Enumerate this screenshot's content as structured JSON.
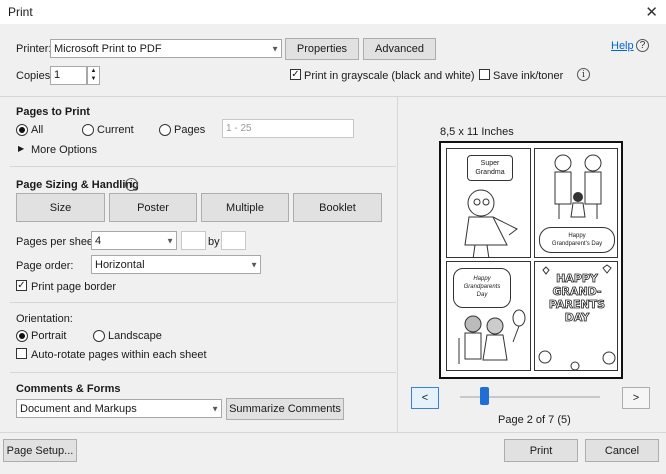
{
  "window": {
    "title": "Print",
    "close": "✕"
  },
  "header": {
    "printer_label": "Printer:",
    "printer_value": "Microsoft Print to PDF",
    "properties_label": "Properties",
    "advanced_label": "Advanced",
    "help_label": "Help",
    "copies_label": "Copies:",
    "copies_value": "1",
    "grayscale_label": "Print in grayscale (black and white)",
    "grayscale_checked": true,
    "save_ink_label": "Save ink/toner",
    "save_ink_checked": false
  },
  "pages_to_print": {
    "heading": "Pages to Print",
    "all_label": "All",
    "current_label": "Current",
    "pages_label": "Pages",
    "range_value": "1 - 25",
    "more_options_label": "More Options",
    "selected": "All"
  },
  "sizing": {
    "heading": "Page Sizing & Handling",
    "tabs": [
      "Size",
      "Poster",
      "Multiple",
      "Booklet"
    ],
    "active_tab": "Multiple",
    "pages_per_sheet_label": "Pages per sheet:",
    "pages_per_sheet_value": "4",
    "by_label": "by",
    "page_order_label": "Page order:",
    "page_order_value": "Horizontal",
    "print_border_label": "Print page border",
    "print_border_checked": true
  },
  "orientation": {
    "heading": "Orientation:",
    "portrait_label": "Portrait",
    "landscape_label": "Landscape",
    "selected": "Portrait",
    "auto_rotate_label": "Auto-rotate pages within each sheet",
    "auto_rotate_checked": false
  },
  "comments": {
    "heading": "Comments & Forms",
    "value": "Document and Markups",
    "summarize_label": "Summarize Comments"
  },
  "preview": {
    "paper_size": "8,5 x 11 Inches",
    "prev_label": "<",
    "next_label": ">",
    "page_status": "Page 2 of 7 (5)",
    "slider_fraction": 0.17,
    "cells": [
      {
        "lines": [
          "Super",
          "Grandma"
        ]
      },
      {
        "lines": [
          "Happy",
          "Grandparent's Day"
        ]
      },
      {
        "lines": [
          "Happy",
          "Grandparents",
          "Day"
        ]
      },
      {
        "lines": [
          "HAPPY",
          "GRAND-",
          "PARENTS",
          "DAY"
        ]
      }
    ]
  },
  "footer": {
    "page_setup_label": "Page Setup...",
    "print_label": "Print",
    "cancel_label": "Cancel"
  },
  "colors": {
    "accent": "#0066cc",
    "button": "#e1e1e1",
    "background": "#f0f0f0"
  }
}
